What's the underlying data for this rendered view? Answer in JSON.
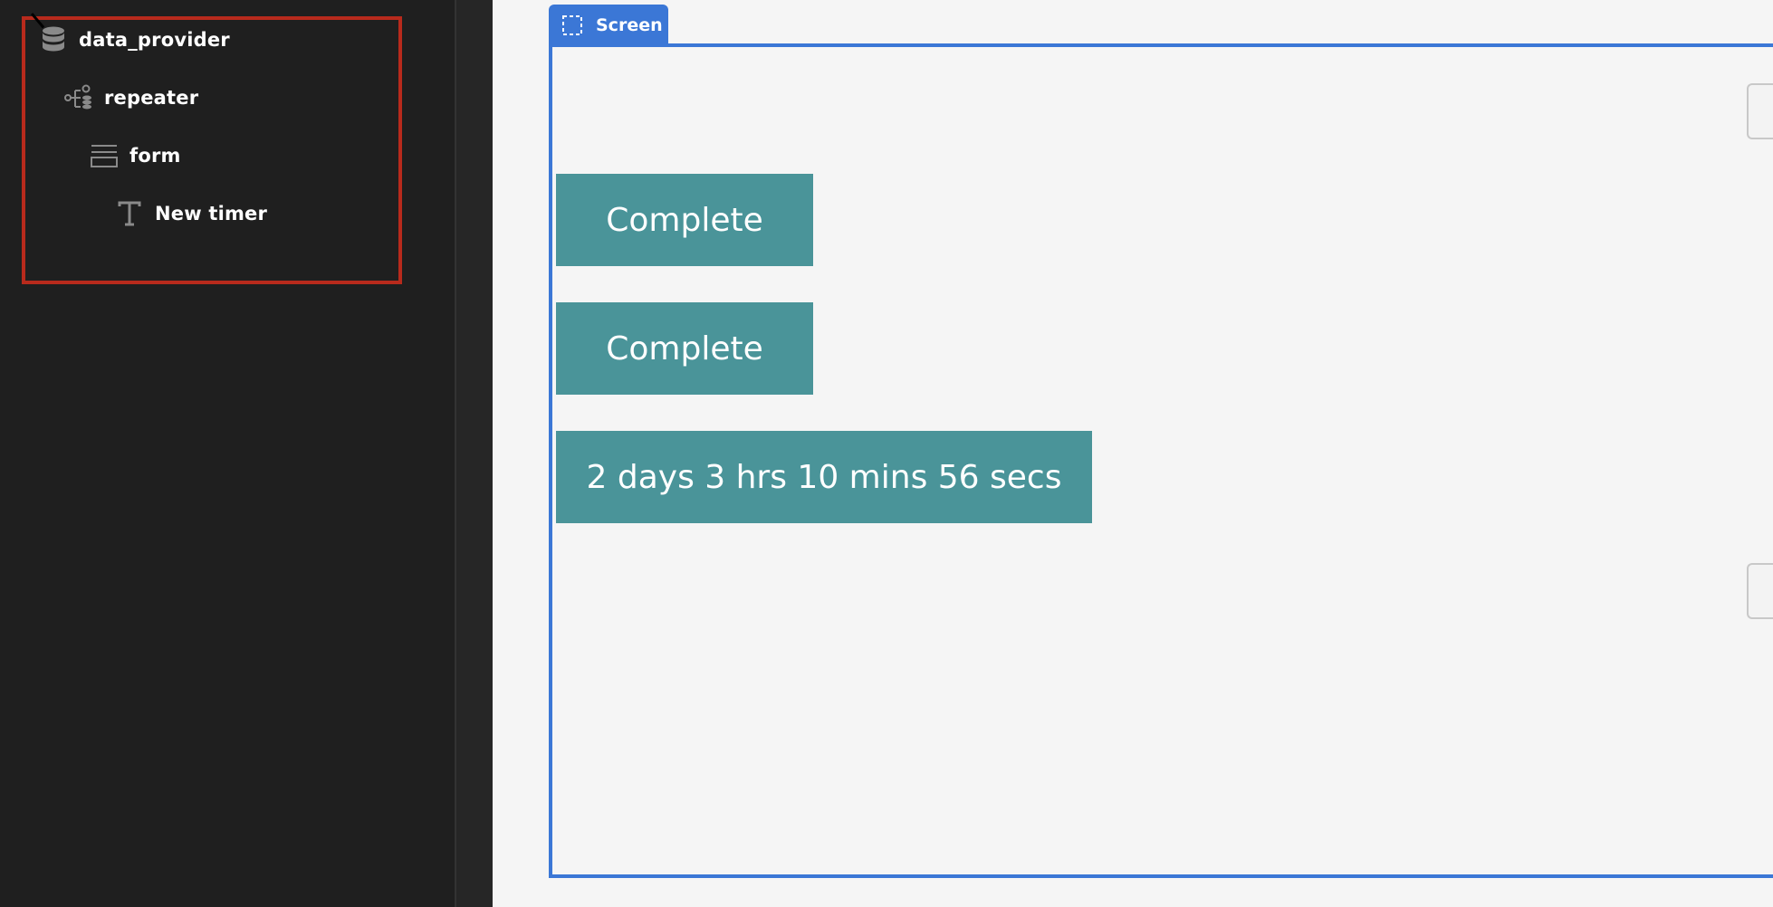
{
  "tree": {
    "nodes": [
      {
        "label": "data_provider",
        "icon": "database-icon"
      },
      {
        "label": "repeater",
        "icon": "repeater-icon"
      },
      {
        "label": "form",
        "icon": "form-icon"
      },
      {
        "label": "New timer",
        "icon": "text-icon"
      }
    ]
  },
  "canvas": {
    "tab_label": "Screen",
    "tab_icon": "selection-icon",
    "timers": [
      {
        "text": "Complete"
      },
      {
        "text": "Complete"
      },
      {
        "text": "2 days 3 hrs 10 mins 56 secs"
      }
    ]
  },
  "colors": {
    "panel_bg": "#1f1f1f",
    "selection_outline": "#b82a1c",
    "accent_blue": "#3b77d6",
    "timer_teal": "#4a9499",
    "canvas_bg": "#f5f5f5"
  }
}
